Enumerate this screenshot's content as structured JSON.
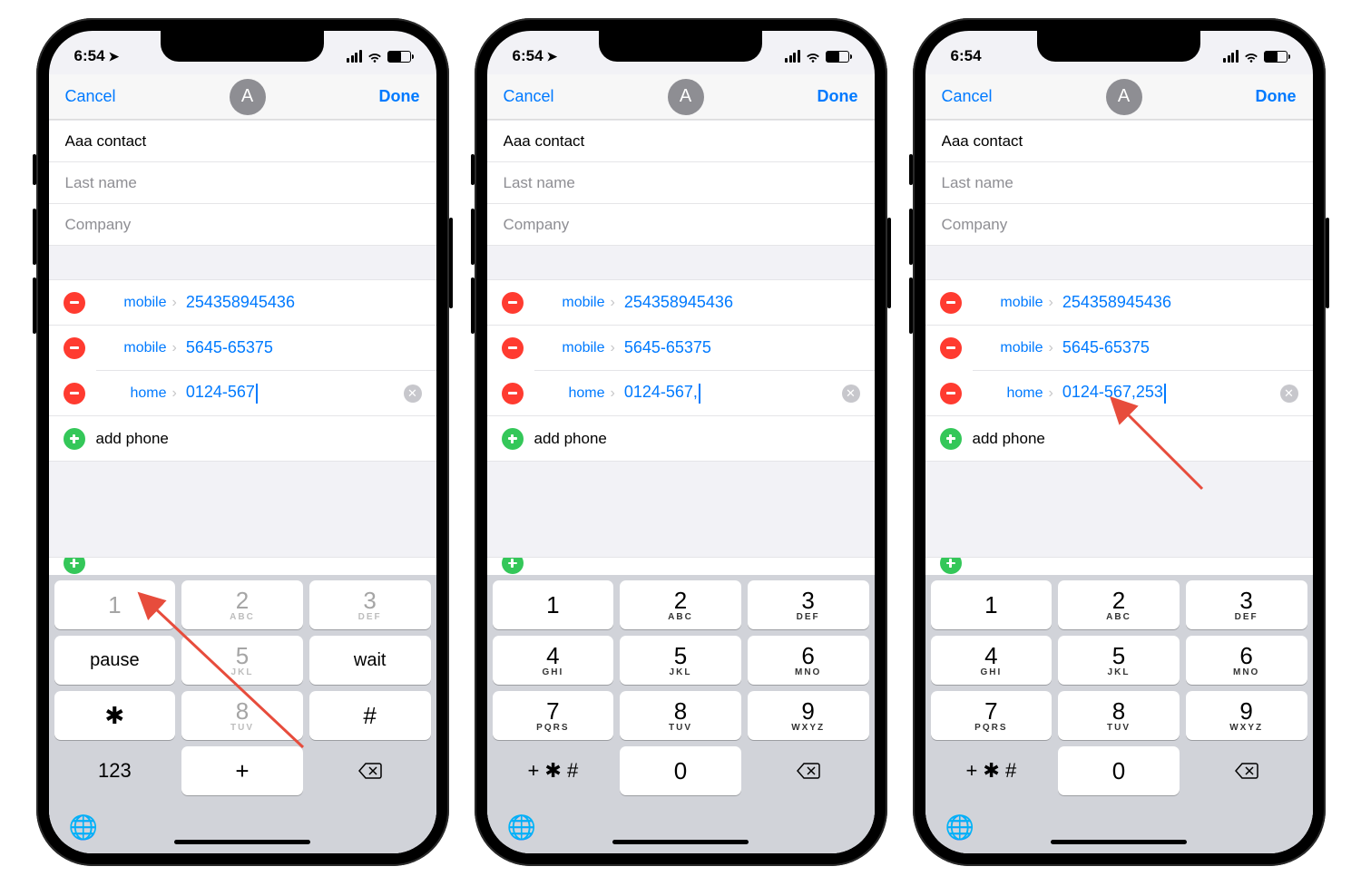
{
  "screens": [
    {
      "status": {
        "time": "6:54",
        "has_location": true
      },
      "nav": {
        "cancel": "Cancel",
        "avatar": "A",
        "done": "Done"
      },
      "fields": {
        "first": "Aaa contact",
        "last_ph": "Last name",
        "company_ph": "Company"
      },
      "phones": [
        {
          "type": "mobile",
          "value": "254358945436"
        },
        {
          "type": "mobile",
          "value": "5645-65375"
        },
        {
          "type": "home",
          "value": "0124-567",
          "active": true
        }
      ],
      "add": "add phone",
      "keypad_mode": "alt",
      "keys_alt": {
        "r2": [
          "pause",
          "5",
          "wait"
        ],
        "r3": [
          "✱",
          "8",
          "#"
        ],
        "r4": [
          "123",
          "+"
        ]
      },
      "annotation_arrow": "pause"
    },
    {
      "status": {
        "time": "6:54",
        "has_location": true
      },
      "nav": {
        "cancel": "Cancel",
        "avatar": "A",
        "done": "Done"
      },
      "fields": {
        "first": "Aaa contact",
        "last_ph": "Last name",
        "company_ph": "Company"
      },
      "phones": [
        {
          "type": "mobile",
          "value": "254358945436"
        },
        {
          "type": "mobile",
          "value": "5645-65375"
        },
        {
          "type": "home",
          "value": "0124-567,",
          "active": true
        }
      ],
      "add": "add phone",
      "keypad_mode": "num",
      "keys_num": {
        "labels": [
          "1",
          "2",
          "3",
          "4",
          "5",
          "6",
          "7",
          "8",
          "9",
          "0"
        ],
        "subs": [
          "",
          "ABC",
          "DEF",
          "GHI",
          "JKL",
          "MNO",
          "PQRS",
          "TUV",
          "WXYZ",
          ""
        ],
        "sym": "+ ✱ #"
      }
    },
    {
      "status": {
        "time": "6:54",
        "has_location": false
      },
      "nav": {
        "cancel": "Cancel",
        "avatar": "A",
        "done": "Done"
      },
      "fields": {
        "first": "Aaa contact",
        "last_ph": "Last name",
        "company_ph": "Company"
      },
      "phones": [
        {
          "type": "mobile",
          "value": "254358945436"
        },
        {
          "type": "mobile",
          "value": "5645-65375"
        },
        {
          "type": "home",
          "value": "0124-567,253",
          "active": true
        }
      ],
      "add": "add phone",
      "keypad_mode": "num",
      "keys_num": {
        "labels": [
          "1",
          "2",
          "3",
          "4",
          "5",
          "6",
          "7",
          "8",
          "9",
          "0"
        ],
        "subs": [
          "",
          "ABC",
          "DEF",
          "GHI",
          "JKL",
          "MNO",
          "PQRS",
          "TUV",
          "WXYZ",
          ""
        ],
        "sym": "+ ✱ #"
      },
      "annotation_arrow": "value"
    }
  ]
}
